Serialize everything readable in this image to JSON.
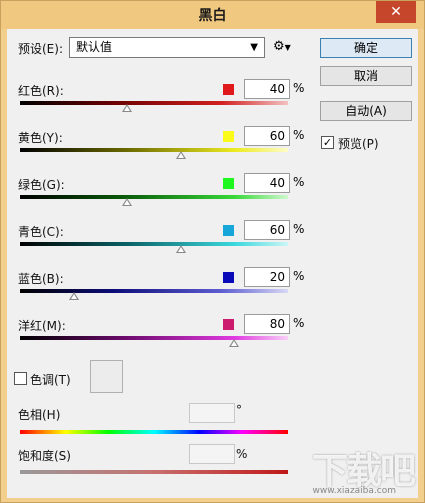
{
  "window": {
    "title": "黑白",
    "close": "✕"
  },
  "preset": {
    "label": "预设(E):",
    "value": "默认值",
    "gear": "⚙"
  },
  "buttons": {
    "ok": "确定",
    "cancel": "取消",
    "auto": "自动(A)"
  },
  "preview": {
    "label": "预览(P)",
    "checked": true
  },
  "sliders": [
    {
      "label": "红色(R):",
      "value": "40",
      "unit": "%",
      "swatch": "#e0191d",
      "percent": 40,
      "grad": "linear-gradient(to right,#000,#6b0000 35%,#d12020 75%,#f3c1c1)"
    },
    {
      "label": "黄色(Y):",
      "value": "60",
      "unit": "%",
      "swatch": "#fbfb1a",
      "percent": 60,
      "grad": "linear-gradient(to right,#000,#6b6a00 40%,#ecea20 80%,#fdfcc8)"
    },
    {
      "label": "绿色(G):",
      "value": "40",
      "unit": "%",
      "swatch": "#1ef81e",
      "percent": 40,
      "grad": "linear-gradient(to right,#000,#0a5e0a 40%,#38d838 80%,#cff7cf)"
    },
    {
      "label": "青色(C):",
      "value": "60",
      "unit": "%",
      "swatch": "#17a6d9",
      "percent": 60,
      "grad": "linear-gradient(to right,#000,#0a6266 40%,#3ad8dd 80%,#cbf6f7)"
    },
    {
      "label": "蓝色(B):",
      "value": "20",
      "unit": "%",
      "swatch": "#0a0ab9",
      "percent": 20,
      "grad": "linear-gradient(to right,#000,#0d0d7a 35%,#5d5dd2 75%,#d8d8f4)"
    },
    {
      "label": "洋红(M):",
      "value": "80",
      "unit": "%",
      "swatch": "#cc1a6e",
      "percent": 80,
      "grad": "linear-gradient(to right,#000,#6e0a6e 40%,#e03ae0 80%,#f8d0f8)"
    }
  ],
  "tint": {
    "label": "色调(T)",
    "checked": false
  },
  "hue": {
    "label": "色相(H)",
    "unit": "°"
  },
  "saturation": {
    "label": "饱和度(S)",
    "unit": "%"
  },
  "watermark": {
    "big": "下载吧",
    "small": "www.xiazaiba.com"
  }
}
